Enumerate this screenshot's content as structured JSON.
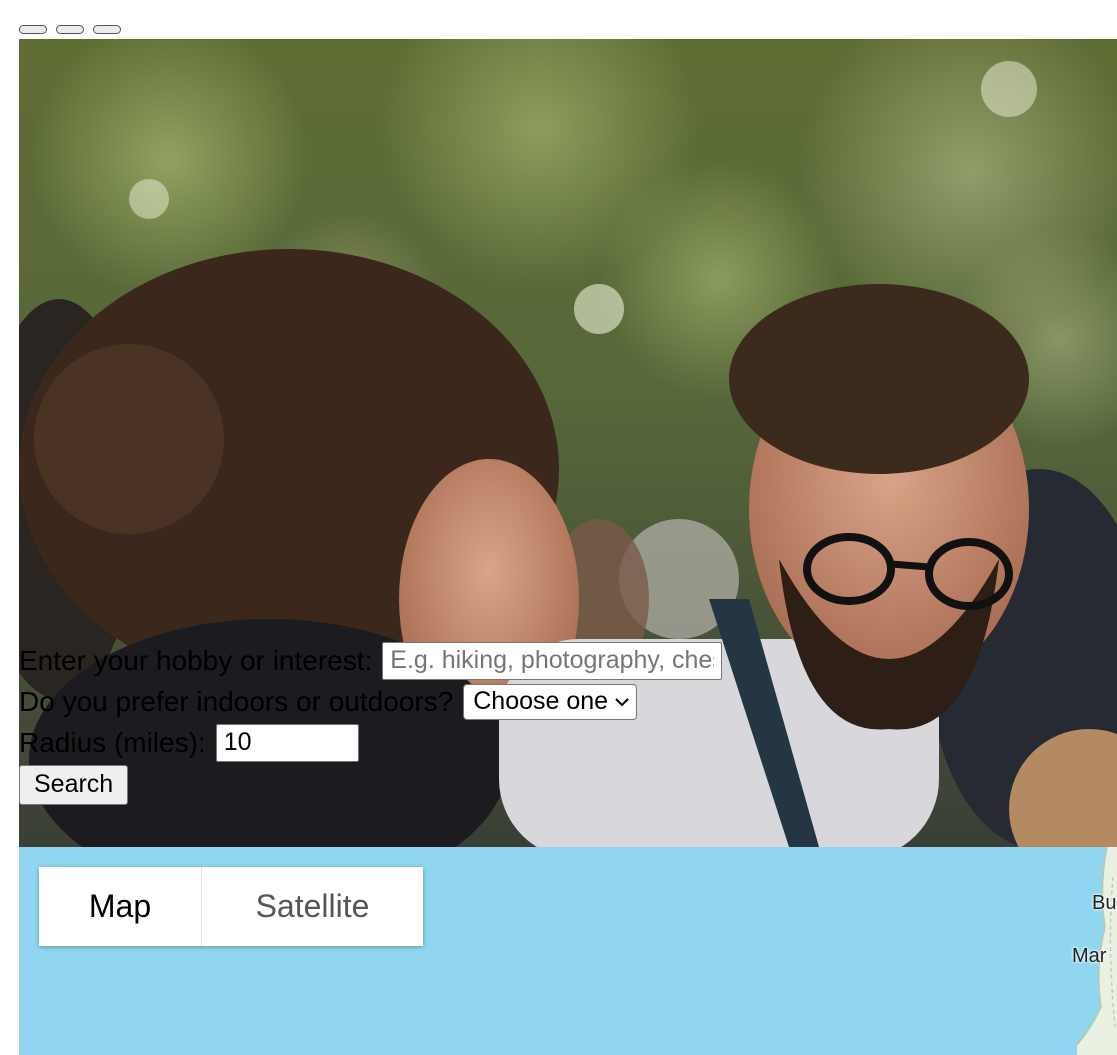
{
  "window": {
    "controls": [
      "minimize",
      "maximize",
      "close"
    ]
  },
  "form": {
    "interest_label": "Enter your hobby or interest:",
    "interest_placeholder": "E.g. hiking, photography, chess",
    "interest_value": "",
    "environment_label": "Do you prefer indoors or outdoors?",
    "environment_selected": "Choose one",
    "radius_label": "Radius (miles):",
    "radius_value": "10",
    "search_label": "Search"
  },
  "map": {
    "type_controls": {
      "map_label": "Map",
      "satellite_label": "Satellite",
      "selected": "Map"
    },
    "places": [
      "Bu",
      "Mar"
    ],
    "water_color": "#8fd6ee",
    "land_color": "#e8f1e2"
  },
  "hero": {
    "icons": [
      "photo-background"
    ]
  }
}
